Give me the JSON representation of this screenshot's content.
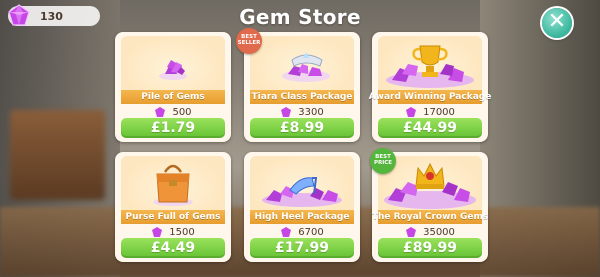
{
  "header": {
    "title": "Gem Store",
    "gem_balance": "130"
  },
  "colors": {
    "gem": "#c646e6",
    "price_button": "#72c93c",
    "name_strip": "#eca639",
    "close_button": "#38b59b"
  },
  "icons": {
    "balance": "gem-icon",
    "close": "close-icon"
  },
  "packages": [
    {
      "name": "Pile of Gems",
      "amount": "500",
      "price": "£1.79",
      "badge": ""
    },
    {
      "name": "Tiara Class Package",
      "amount": "3300",
      "price": "£8.99",
      "badge": "BEST SELLER"
    },
    {
      "name": "Award Winning Package",
      "amount": "17000",
      "price": "£44.99",
      "badge": ""
    },
    {
      "name": "Purse Full of Gems",
      "amount": "1500",
      "price": "£4.49",
      "badge": ""
    },
    {
      "name": "High Heel Package",
      "amount": "6700",
      "price": "£17.99",
      "badge": ""
    },
    {
      "name": "The Royal Crown Gems",
      "amount": "35000",
      "price": "£89.99",
      "badge": "BEST PRICE"
    }
  ]
}
